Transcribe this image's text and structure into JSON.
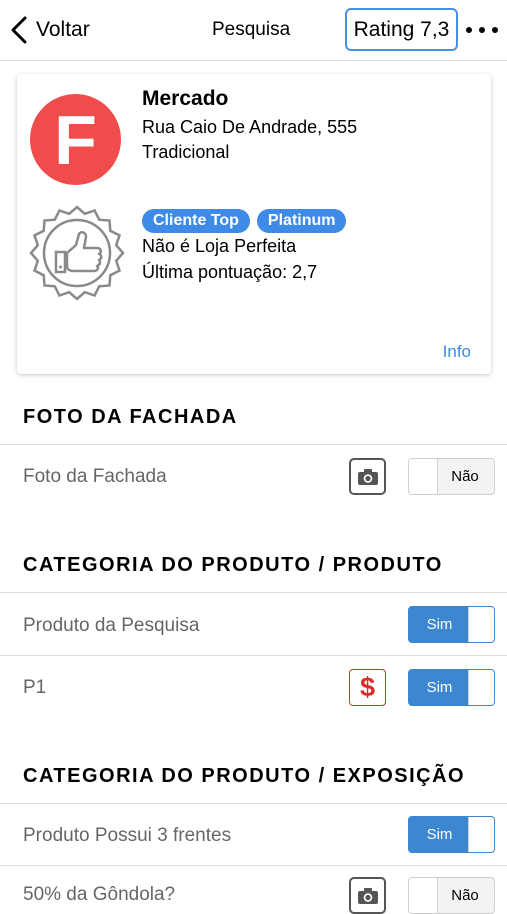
{
  "nav": {
    "back_label": "Voltar",
    "title": "Pesquisa",
    "rating_label": "Rating 7,3"
  },
  "store": {
    "logo_letter": "F",
    "name": "Mercado",
    "address": "Rua Caio De Andrade, 555",
    "type": "Tradicional",
    "badges": [
      "Cliente Top",
      "Platinum"
    ],
    "perfect_store": "Não é Loja Perfeita",
    "last_score": "Última pontuação: 2,7",
    "info_link": "Info",
    "colors": {
      "logo": "#f04c4c",
      "badge": "#3d8be6"
    }
  },
  "sections": [
    {
      "title": "FOTO DA FACHADA",
      "rows": [
        {
          "label": "Foto da Fachada",
          "icon": "camera-icon",
          "value": "Não"
        }
      ]
    },
    {
      "title": "CATEGORIA DO PRODUTO / PRODUTO",
      "rows": [
        {
          "label": "Produto da Pesquisa",
          "value": "Sim"
        },
        {
          "label": "P1",
          "icon": "dollar-icon",
          "value": "Sim"
        }
      ]
    },
    {
      "title": "CATEGORIA DO PRODUTO / EXPOSIÇÃO",
      "rows": [
        {
          "label": "Produto Possui 3 frentes",
          "value": "Sim"
        },
        {
          "label": "50% da Gôndola?",
          "icon": "camera-icon",
          "value": "Não"
        }
      ]
    }
  ],
  "accent_color": "#3d86d0"
}
